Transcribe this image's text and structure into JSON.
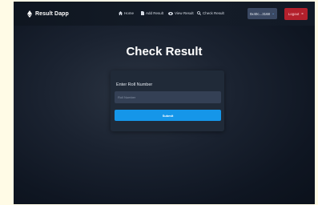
{
  "brand": {
    "name": "Result Dapp",
    "icon": "ethereum-icon"
  },
  "nav": {
    "items": [
      {
        "label": "Home",
        "icon": "home-icon"
      },
      {
        "label": "Add Result",
        "icon": "document-icon"
      },
      {
        "label": "View Result",
        "icon": "eye-icon"
      },
      {
        "label": "Check Result",
        "icon": "search-icon"
      }
    ],
    "wallet": {
      "address": "0x40c...3168",
      "icon": "chevron-down-icon"
    },
    "logout_label": "Logout"
  },
  "page": {
    "title": "Check Result"
  },
  "form": {
    "label": "Enter Roll Number",
    "placeholder": "Roll Number",
    "value": "",
    "submit_label": "Submit"
  },
  "colors": {
    "background": "#131b27",
    "card": "#202a38",
    "input": "#344055",
    "accent": "#1596e9",
    "logout": "#b3202c",
    "wallet": "#3a4862"
  }
}
